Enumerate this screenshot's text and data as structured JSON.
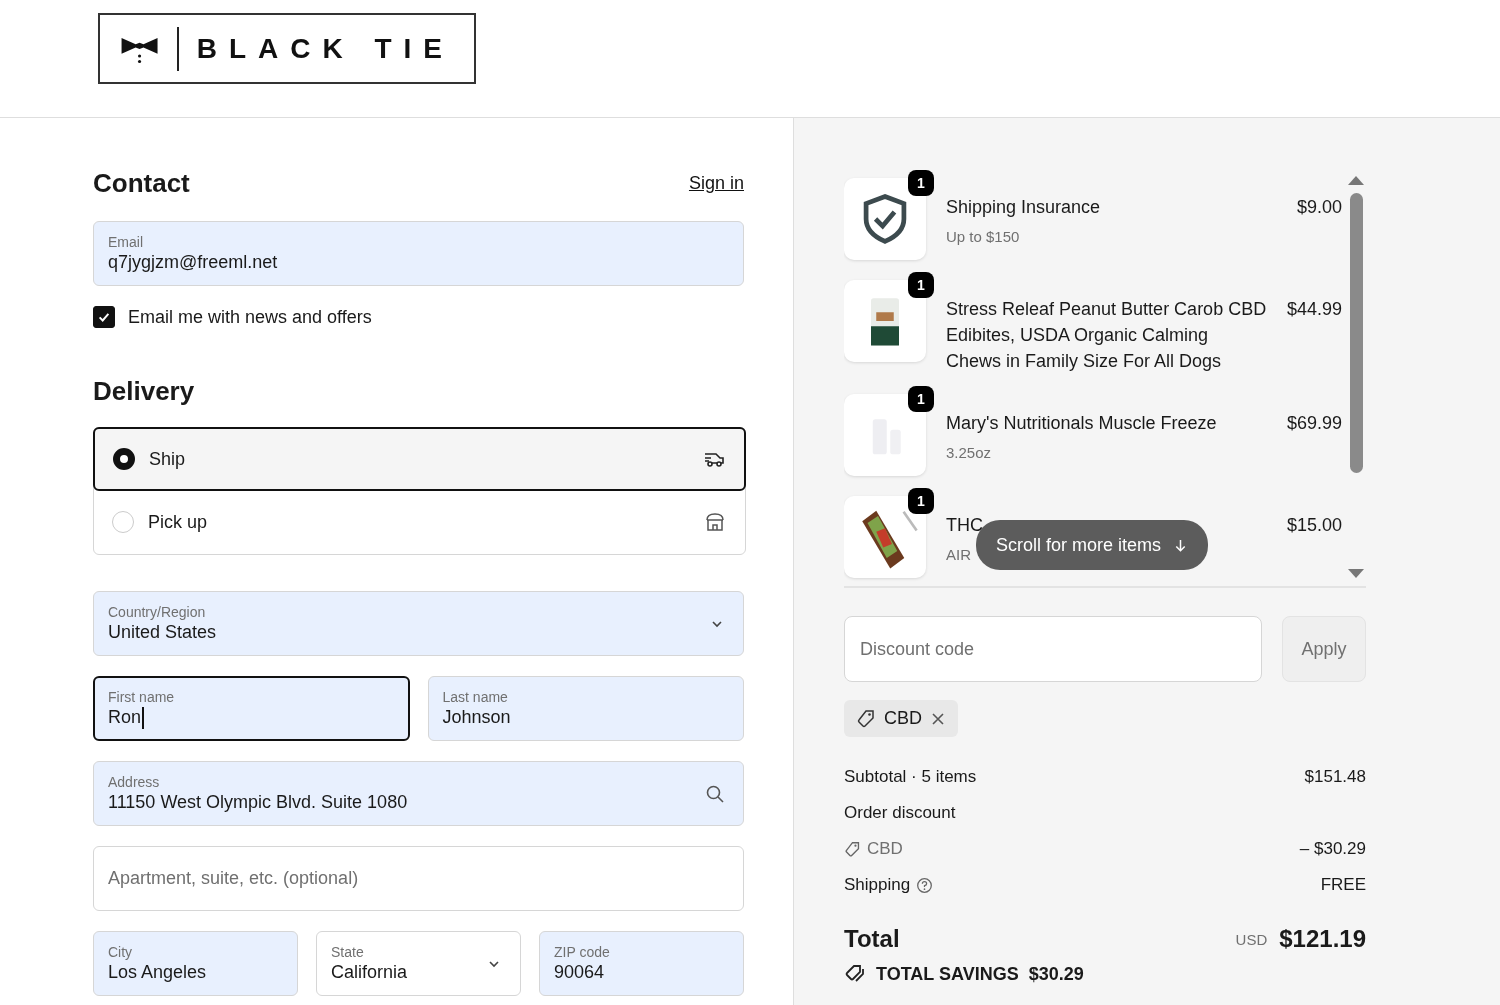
{
  "logo": {
    "text": "BLACK TIE"
  },
  "contact": {
    "title": "Contact",
    "sign_in": "Sign in",
    "email": {
      "label": "Email",
      "value": "q7jygjzm@freeml.net",
      "autofilled": true
    },
    "newsletter": {
      "label": "Email me with news and offers",
      "checked": true
    }
  },
  "delivery": {
    "title": "Delivery",
    "options": [
      {
        "label": "Ship",
        "selected": true,
        "kind": "ship"
      },
      {
        "label": "Pick up",
        "selected": false,
        "kind": "pickup"
      }
    ]
  },
  "address_rows": [
    [
      {
        "kind": "select",
        "label": "Country/Region",
        "value": "United States",
        "autofilled": true,
        "focused": false
      }
    ],
    [
      {
        "kind": "text",
        "label": "First name",
        "value": "Ron",
        "autofilled": true,
        "focused": true
      },
      {
        "kind": "text",
        "label": "Last name",
        "value": "Johnson",
        "autofilled": true,
        "focused": false
      }
    ],
    [
      {
        "kind": "search",
        "label": "Address",
        "value": "11150 West Olympic Blvd. Suite 1080",
        "autofilled": true,
        "focused": false
      }
    ],
    [
      {
        "kind": "text",
        "placeholder": "Apartment, suite, etc. (optional)",
        "autofilled": false,
        "focused": false
      }
    ],
    [
      {
        "kind": "text",
        "label": "City",
        "value": "Los Angeles",
        "autofilled": true,
        "focused": false
      },
      {
        "kind": "select",
        "label": "State",
        "value": "California",
        "autofilled": false,
        "focused": false
      },
      {
        "kind": "text",
        "label": "ZIP code",
        "value": "90064",
        "autofilled": true,
        "focused": false
      }
    ]
  ],
  "cart": {
    "items": [
      {
        "kind": "shield",
        "quantity": "1",
        "title": "Shipping Insurance",
        "subtitle": "Up to $150",
        "price": "$9.00"
      },
      {
        "kind": "picture",
        "quantity": "1",
        "title": "Stress Releaf Peanut Butter Carob CBD Edibites, USDA Organic Calming Chews in Family Size For All Dogs",
        "price": "$44.99"
      },
      {
        "kind": "picture",
        "quantity": "1",
        "title": "Mary's Nutritionals Muscle Freeze",
        "subtitle": "3.25oz",
        "price": "$69.99"
      },
      {
        "kind": "picture",
        "quantity": "1",
        "title": "THC",
        "subtitle": "AIR",
        "price": "$15.00"
      }
    ],
    "scroll_hint": "Scroll for more items"
  },
  "discount": {
    "placeholder": "Discount code",
    "apply": "Apply",
    "applied_code": "CBD"
  },
  "summary": {
    "subtotal_label": "Subtotal · 5 items",
    "subtotal": "$151.48",
    "discount_label": "Order discount",
    "discount_code": "CBD",
    "discount_amount": "– $30.29",
    "shipping_label": "Shipping",
    "shipping": "FREE",
    "total_label": "Total",
    "currency": "USD",
    "total": "$121.19",
    "savings_label": "TOTAL SAVINGS",
    "savings": "$30.29"
  }
}
